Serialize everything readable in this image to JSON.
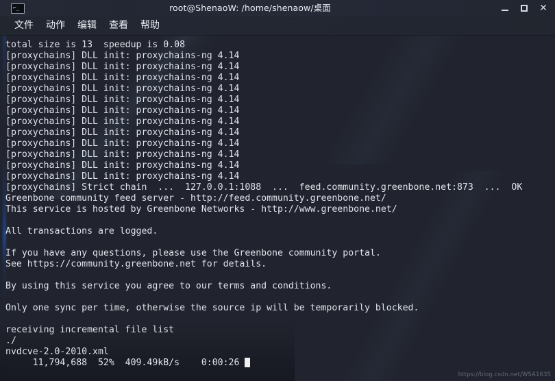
{
  "window": {
    "title": "root@ShenaoW: /home/shenaow/桌面",
    "icon_name": "terminal-icon",
    "icon_prompt": "⌐_",
    "controls": {
      "minimize": "minimize-icon",
      "maximize": "maximize-icon",
      "close": "✕"
    }
  },
  "menubar": {
    "items": [
      {
        "label": "文件",
        "name": "menu-file"
      },
      {
        "label": "动作",
        "name": "menu-actions"
      },
      {
        "label": "编辑",
        "name": "menu-edit"
      },
      {
        "label": "查看",
        "name": "menu-view"
      },
      {
        "label": "帮助",
        "name": "menu-help"
      }
    ]
  },
  "terminal": {
    "background": "#21242e",
    "foreground": "#dfe3ea",
    "cursor_color": "#f0f0f0",
    "lines": [
      "total size is 13  speedup is 0.08",
      "[proxychains] DLL init: proxychains-ng 4.14",
      "[proxychains] DLL init: proxychains-ng 4.14",
      "[proxychains] DLL init: proxychains-ng 4.14",
      "[proxychains] DLL init: proxychains-ng 4.14",
      "[proxychains] DLL init: proxychains-ng 4.14",
      "[proxychains] DLL init: proxychains-ng 4.14",
      "[proxychains] DLL init: proxychains-ng 4.14",
      "[proxychains] DLL init: proxychains-ng 4.14",
      "[proxychains] DLL init: proxychains-ng 4.14",
      "[proxychains] DLL init: proxychains-ng 4.14",
      "[proxychains] DLL init: proxychains-ng 4.14",
      "[proxychains] DLL init: proxychains-ng 4.14",
      "[proxychains] Strict chain  ...  127.0.0.1:1088  ...  feed.community.greenbone.net:873  ...  OK",
      "Greenbone community feed server - http://feed.community.greenbone.net/",
      "This service is hosted by Greenbone Networks - http://www.greenbone.net/",
      "",
      "All transactions are logged.",
      "",
      "If you have any questions, please use the Greenbone community portal.",
      "See https://community.greenbone.net for details.",
      "",
      "By using this service you agree to our terms and conditions.",
      "",
      "Only one sync per time, otherwise the source ip will be temporarily blocked.",
      "",
      "receiving incremental file list",
      "./",
      "nvdcve-2.0-2010.xml",
      "     11,794,688  52%  409.49kB/s    0:00:26 "
    ],
    "cursor_on_last_line": true
  },
  "watermark": {
    "text": "https://blog.csdn.net/WSA1635"
  }
}
